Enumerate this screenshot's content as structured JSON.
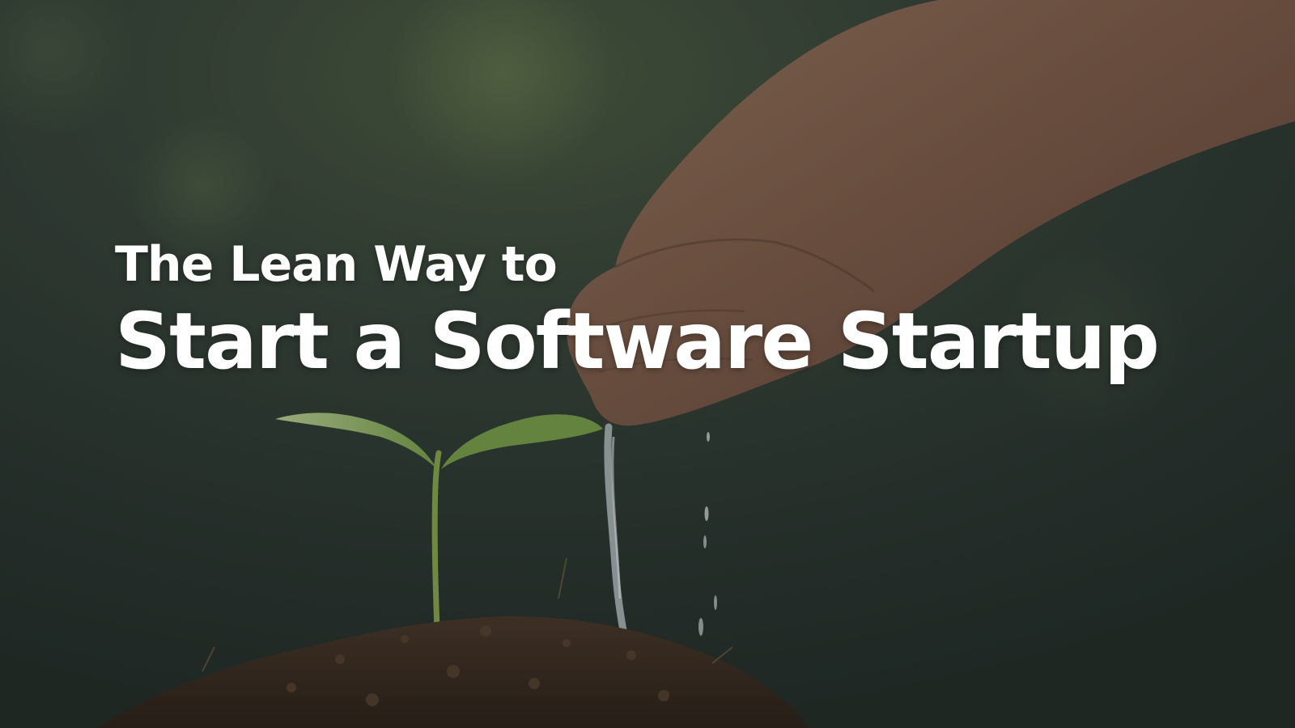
{
  "hero": {
    "title_line1": "The Lean Way to",
    "title_line2": "Start a Software Startup",
    "text_color": "#ffffff",
    "background_tint": "#2a3430"
  },
  "image": {
    "subject": "hand-watering-seedling-image"
  }
}
